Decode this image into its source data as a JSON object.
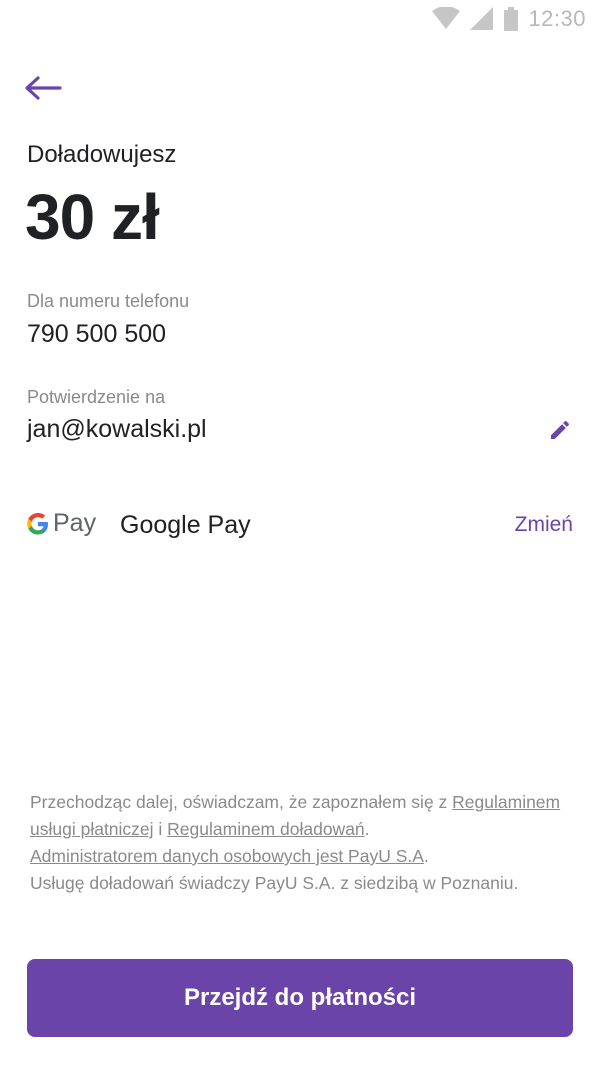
{
  "status_bar": {
    "time": "12:30",
    "icons": [
      "wifi-icon",
      "signal-icon",
      "battery-icon"
    ]
  },
  "header": {
    "back_icon": "arrow-left-icon"
  },
  "topup": {
    "label": "Doładowujesz",
    "amount": "30 zł"
  },
  "phone": {
    "label": "Dla numeru telefonu",
    "value": "790 500 500"
  },
  "confirmation": {
    "label": "Potwierdzenie na",
    "value": "jan@kowalski.pl",
    "edit_icon": "pencil-icon"
  },
  "payment": {
    "logo_text": "Pay",
    "logo_icon": "google-g-icon",
    "method": "Google Pay",
    "change_label": "Zmień"
  },
  "disclaimer": {
    "part1": "Przechodząc dalej, oświadczam, że zapoznałem się z ",
    "link1": "Regulaminem usługi płatniczej",
    "part2": " i ",
    "link2": "Regulaminem doładowań",
    "part3": ".",
    "link3": "Administratorem danych osobowych jest PayU S.A",
    "part4": ".",
    "part5": "Usługę doładowań świadczy PayU S.A. z siedzibą w Poznaniu."
  },
  "cta": {
    "label": "Przejdź do płatności"
  },
  "colors": {
    "accent": "#6a44a8",
    "text": "#202124",
    "muted": "#8a8a8a"
  }
}
